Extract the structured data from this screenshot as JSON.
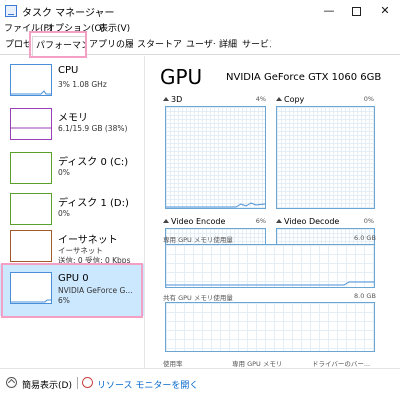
{
  "window": {
    "title": "タスク マネージャー",
    "minimize": "—",
    "close": "✕"
  },
  "menu": [
    "ファイル(F)",
    "オプション(O)",
    "表示(V)"
  ],
  "tabs": [
    {
      "label": "プロセス"
    },
    {
      "label": "パフォーマンス",
      "active": true
    },
    {
      "label": "アプリの履歴"
    },
    {
      "label": "スタートアップ"
    },
    {
      "label": "ユーザー"
    },
    {
      "label": "詳細"
    },
    {
      "label": "サービス"
    }
  ],
  "sidebar": [
    {
      "name": "CPU",
      "detail": "3% 1.08 GHz",
      "color": "#4a90d9"
    },
    {
      "name": "メモリ",
      "detail": "6.1/15.9 GB (38%)",
      "color": "#9b3fb5"
    },
    {
      "name": "ディスク 0 (C:)",
      "detail": "0%",
      "color": "#5aa02c"
    },
    {
      "name": "ディスク 1 (D:)",
      "detail": "0%",
      "color": "#5aa02c"
    },
    {
      "name": "イーサネット",
      "detail": "イーサネット",
      "detail2": "送信: 0 受信: 0 Kbps",
      "color": "#a05a2c"
    },
    {
      "name": "GPU 0",
      "detail": "NVIDIA GeForce G...",
      "detail2": "6%",
      "color": "#4a90d9",
      "selected": true
    }
  ],
  "gpu": {
    "title": "GPU",
    "model": "NVIDIA GeForce GTX 1060 6GB",
    "engines": [
      {
        "label": "3D",
        "percent": "4%",
        "right_percent": "0%",
        "level": 0.04
      },
      {
        "label": "Copy",
        "percent": "0%",
        "right_percent": "0%",
        "level": 0
      },
      {
        "label": "Video Encode",
        "percent": "6%",
        "right_percent": "0%",
        "level": 0.06
      },
      {
        "label": "Video Decode",
        "percent": "0%",
        "right_percent": "0%",
        "level": 0
      }
    ],
    "dedicated_memory": {
      "label": "専用 GPU メモリ使用量",
      "max": "6.0 GB",
      "usage_fraction": 0.07
    },
    "shared_memory": {
      "label": "共有 GPU メモリ使用量",
      "max": "8.0 GB"
    },
    "bottom_labels": [
      "使用率",
      "専用 GPU メモリ",
      "ドライバーのバー..."
    ]
  },
  "status": {
    "fewer_details": "簡易表示(D)",
    "resource_monitor": "リソース モニターを開く"
  }
}
